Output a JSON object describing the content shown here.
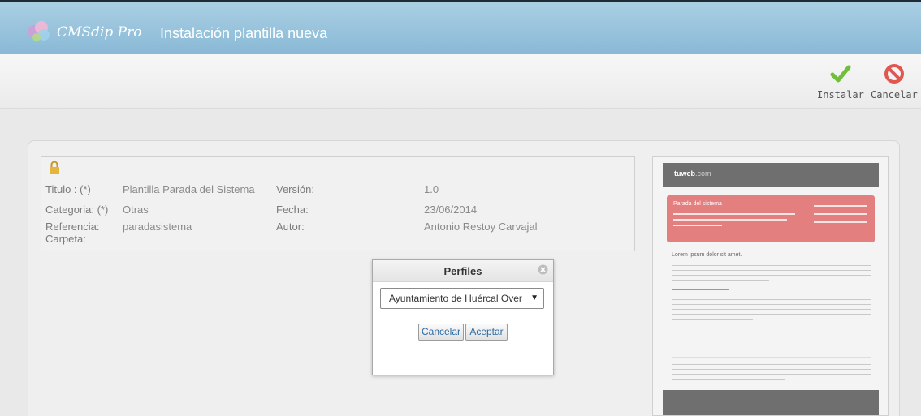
{
  "header": {
    "brand": "CMSdip Pro",
    "title": "Instalación plantilla nueva"
  },
  "toolbar": {
    "install_label": "Instalar",
    "cancel_label": "Cancelar"
  },
  "template_info": {
    "titulo_label": "Titulo : (*)",
    "titulo_value": "Plantilla Parada del Sistema",
    "categoria_label": "Categoria: (*)",
    "categoria_value": "Otras",
    "referencia_label": "Referencia:",
    "referencia_value": "paradasistema",
    "carpeta_label": "Carpeta:",
    "version_label": "Versión:",
    "version_value": "1.0",
    "fecha_label": "Fecha:",
    "fecha_value": "23/06/2014",
    "autor_label": "Autor:",
    "autor_value": "Antonio Restoy Carvajal"
  },
  "dialog": {
    "title": "Perfiles",
    "selected_profile": "Ayuntamiento de Huércal Over",
    "cancel_label": "Cancelar",
    "accept_label": "Aceptar"
  },
  "preview": {
    "logo_main": "tuweb",
    "logo_suffix": ".com",
    "hero_title": "Parada del sistema",
    "heading": "Lorem ipsum dolor sit amet."
  },
  "colors": {
    "header_bg": "#8ab9d6",
    "install_icon": "#6fbf3a",
    "cancel_icon": "#e0574f",
    "preview_hero": "#e47f7f"
  },
  "icons": {
    "logo": "cmsdip-logo-icon",
    "install": "checkmark-icon",
    "cancel": "prohibited-icon",
    "lock": "lock-icon",
    "dialog_close": "close-icon",
    "select_arrow": "chevron-down-icon"
  }
}
